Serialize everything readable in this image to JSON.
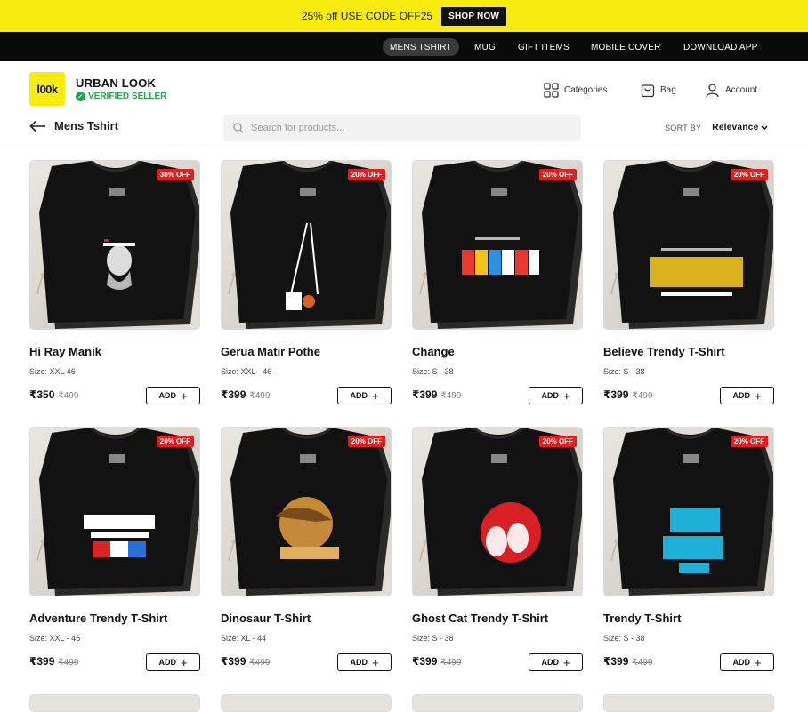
{
  "promo": {
    "text": "25% off USE CODE OFF25",
    "button": "SHOP NOW"
  },
  "topnav": [
    "MENS TSHIRT",
    "MUG",
    "GIFT ITEMS",
    "MOBILE COVER",
    "DOWNLOAD APP"
  ],
  "store": {
    "logo_text": "l00k",
    "name": "URBAN LOOK",
    "verified": "VERIFIED SELLER"
  },
  "header_links": {
    "categories": "Categories",
    "bag": "Bag",
    "account": "Account"
  },
  "page": {
    "title": "Mens Tshirt"
  },
  "search": {
    "placeholder": "Search for products..."
  },
  "sort": {
    "label": "SORT BY",
    "value": "Relevance"
  },
  "add_label": "ADD",
  "products": [
    {
      "name": "Hi Ray Manik",
      "size": "Size: XXL 46",
      "price": "₹350",
      "mrp": "₹499",
      "discount": "30% OFF",
      "print": "ray",
      "print_colors": [
        "#ffffff",
        "#d01f1f"
      ]
    },
    {
      "name": "Gerua Matir Pothe",
      "size": "Size: XXL - 46",
      "price": "₹399",
      "mrp": "₹499",
      "discount": "20% OFF",
      "print": "gerua",
      "print_colors": [
        "#ffffff",
        "#e0602a"
      ]
    },
    {
      "name": "Change",
      "size": "Size: S - 38",
      "price": "₹399",
      "mrp": "₹499",
      "discount": "20% OFF",
      "print": "change",
      "print_colors": [
        "#e63a2f",
        "#f5c21b",
        "#2f8fe0",
        "#ffffff"
      ]
    },
    {
      "name": "Believe Trendy T-Shirt",
      "size": "Size: S - 38",
      "price": "₹399",
      "mrp": "₹499",
      "discount": "20% OFF",
      "print": "believe",
      "print_colors": [
        "#d9b21e",
        "#ffffff"
      ]
    },
    {
      "name": "Adventure Trendy T-Shirt",
      "size": "Size: XXL - 46",
      "price": "₹399",
      "mrp": "₹499",
      "discount": "20% OFF",
      "print": "adventure",
      "print_colors": [
        "#ffffff",
        "#d92525",
        "#2d6fd8"
      ]
    },
    {
      "name": "Dinosaur T-Shirt",
      "size": "Size: XL - 44",
      "price": "₹399",
      "mrp": "₹499",
      "discount": "20% OFF",
      "print": "dino",
      "print_colors": [
        "#c48a3a",
        "#e0b060",
        "#7a4a1c"
      ]
    },
    {
      "name": "Ghost Cat Trendy T-Shirt",
      "size": "Size: S - 38",
      "price": "₹399",
      "mrp": "₹499",
      "discount": "20% OFF",
      "print": "cat",
      "print_colors": [
        "#d81f26",
        "#ffffff"
      ]
    },
    {
      "name": "Trendy T-Shirt",
      "size": "Size: S - 38",
      "price": "₹399",
      "mrp": "₹499",
      "discount": "20% OFF",
      "print": "mind",
      "print_colors": [
        "#1fb0d8"
      ]
    }
  ]
}
